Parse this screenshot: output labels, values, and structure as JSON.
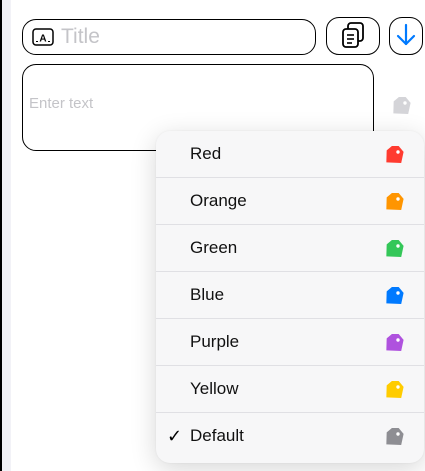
{
  "title_field": {
    "placeholder": "Title",
    "value": ""
  },
  "text_area": {
    "placeholder": "Enter text",
    "value": ""
  },
  "toolbar": {
    "copy_icon": "doc-on-doc-icon",
    "download_icon": "arrow-down-icon"
  },
  "background_tag": {
    "icon": "tag-icon",
    "color": "#d4d4d8"
  },
  "tag_menu": {
    "selected": "Default",
    "items": [
      {
        "label": "Red",
        "color": "#ff3b30",
        "checked": false
      },
      {
        "label": "Orange",
        "color": "#ff9500",
        "checked": false
      },
      {
        "label": "Green",
        "color": "#34c759",
        "checked": false
      },
      {
        "label": "Blue",
        "color": "#007aff",
        "checked": false
      },
      {
        "label": "Purple",
        "color": "#af52de",
        "checked": false
      },
      {
        "label": "Yellow",
        "color": "#ffcc00",
        "checked": false
      },
      {
        "label": "Default",
        "color": "#8e8e93",
        "checked": true
      }
    ],
    "check_glyph": "✓"
  }
}
